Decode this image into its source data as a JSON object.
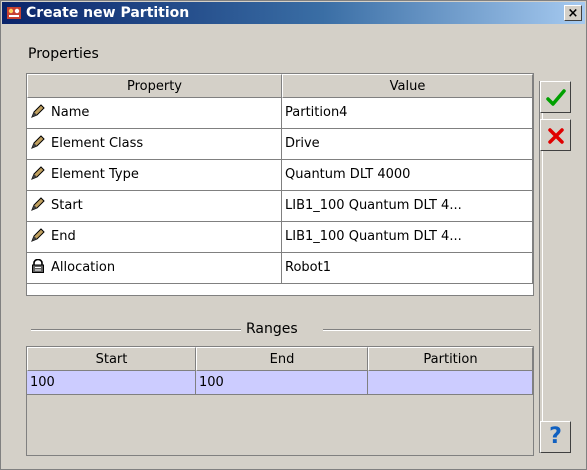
{
  "window": {
    "title": "Create new Partition",
    "close_glyph": "×"
  },
  "properties": {
    "section_label": "Properties",
    "columns": [
      "Property",
      "Value"
    ],
    "rows": [
      {
        "icon": "pencil-icon",
        "property": "Name",
        "value": "Partition4"
      },
      {
        "icon": "pencil-icon",
        "property": "Element Class",
        "value": "Drive"
      },
      {
        "icon": "pencil-icon",
        "property": "Element Type",
        "value": "Quantum DLT 4000"
      },
      {
        "icon": "pencil-icon",
        "property": "Start",
        "value": "LIB1_100 Quantum DLT 4..."
      },
      {
        "icon": "pencil-icon",
        "property": "End",
        "value": "LIB1_100 Quantum DLT 4..."
      },
      {
        "icon": "lock-icon",
        "property": "Allocation",
        "value": "Robot1"
      }
    ]
  },
  "ranges": {
    "section_label": "Ranges",
    "columns": [
      "Start",
      "End",
      "Partition"
    ],
    "rows": [
      {
        "start": "100",
        "end": "100",
        "partition": ""
      }
    ],
    "selected_row_color": "#ccccff"
  },
  "side_buttons": {
    "ok_icon": "checkmark-icon",
    "ok_color": "#00a000",
    "cancel_icon": "red-x-icon",
    "cancel_color": "#e00000",
    "help_icon": "question-mark-icon",
    "help_glyph": "?"
  },
  "colors": {
    "titlebar_start": "#0a246a",
    "titlebar_end": "#a6caf0",
    "window_bg": "#d4d0c8"
  }
}
